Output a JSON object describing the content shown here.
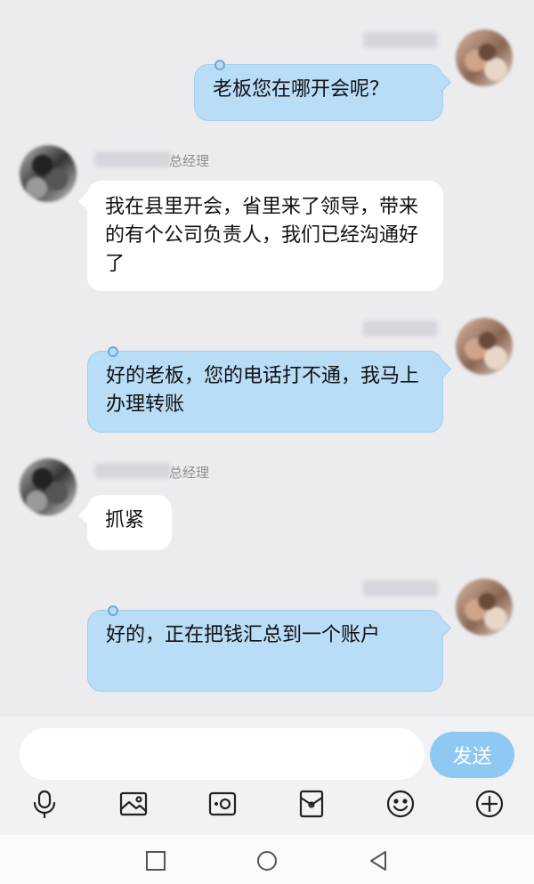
{
  "messages": [
    {
      "sender": "me",
      "text": "老板您在哪开会呢？"
    },
    {
      "sender": "boss",
      "name_suffix": "总经理",
      "text": "我在县里开会，省里来了领导，带来的有个公司负责人，我们已经沟通好了"
    },
    {
      "sender": "me",
      "text": "好的老板，您的电话打不通，我马上办理转账"
    },
    {
      "sender": "boss",
      "name_suffix": "总经理",
      "text": "抓紧"
    },
    {
      "sender": "me",
      "text": "好的，正在把钱汇总到一个账户"
    }
  ],
  "input": {
    "value": "",
    "send_label": "发送"
  },
  "toolbar": [
    "microphone-icon",
    "image-icon",
    "camera-icon",
    "red-packet-icon",
    "emoji-icon",
    "plus-icon"
  ],
  "navigation": [
    "recent-apps-icon",
    "home-icon",
    "back-icon"
  ],
  "colors": {
    "my_bubble": "#b9dcf7",
    "their_bubble": "#ffffff",
    "send_button": "#8ec8f3",
    "background": "#ececef"
  }
}
